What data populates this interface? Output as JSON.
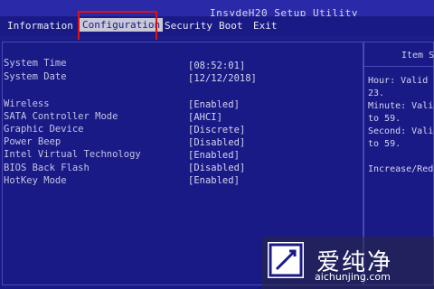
{
  "title": "InsydeH20 Setup Utility",
  "menu": [
    {
      "label": "Information",
      "active": false
    },
    {
      "label": "Configuration",
      "active": true
    },
    {
      "label": "Security",
      "active": false
    },
    {
      "label": "Boot",
      "active": false
    },
    {
      "label": "Exit",
      "active": false
    }
  ],
  "settings": [
    {
      "label": "System Time",
      "value": "[08:52:01]"
    },
    {
      "label": "System Date",
      "value": "[12/12/2018]"
    },
    {
      "label": "Wireless",
      "value": "[Enabled]"
    },
    {
      "label": "SATA Controller Mode",
      "value": "[AHCI]"
    },
    {
      "label": "Graphic Device",
      "value": "[Discrete]"
    },
    {
      "label": "Power Beep",
      "value": "[Disabled]"
    },
    {
      "label": "Intel Virtual Technology",
      "value": "[Enabled]"
    },
    {
      "label": "BIOS Back Flash",
      "value": "[Disabled]"
    },
    {
      "label": "HotKey Mode",
      "value": "[Enabled]"
    }
  ],
  "help": {
    "title": "Item S",
    "lines": [
      "Hour: Valid r",
      "23.",
      "Minute: Valid",
      "to 59.",
      "Second: Valid",
      "to 59.",
      "",
      "Increase/Redu"
    ]
  },
  "watermark": {
    "brand": "爱纯净",
    "url": "aichunjing.com"
  },
  "colors": {
    "background": "#1d1d8c",
    "highlight_border": "#e01010",
    "text": "#c4c4e4"
  }
}
